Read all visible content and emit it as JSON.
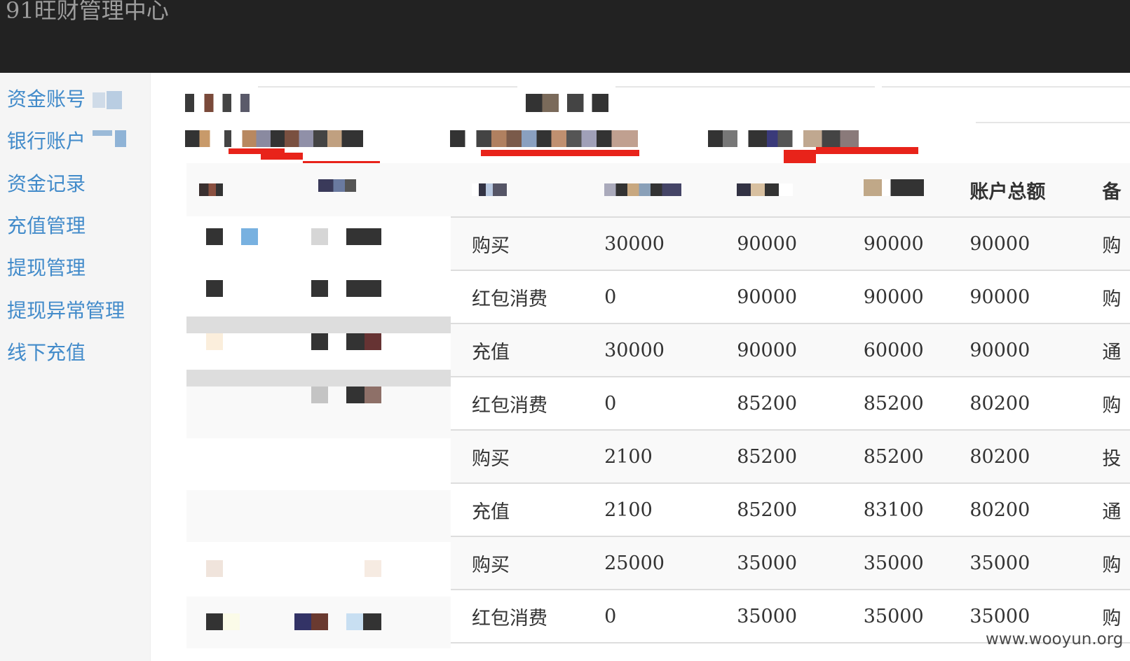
{
  "header": {
    "brand": "91旺财管理中心"
  },
  "sidebar": {
    "items": [
      {
        "label": "资金账号"
      },
      {
        "label": "银行账户"
      },
      {
        "label": "资金记录"
      },
      {
        "label": "充值管理"
      },
      {
        "label": "提现管理"
      },
      {
        "label": "提现异常管理"
      },
      {
        "label": "线下充值"
      }
    ]
  },
  "table": {
    "headers": [
      "",
      "",
      "",
      "",
      "账户总额",
      "备"
    ],
    "rows": [
      [
        "购买",
        "30000",
        "90000",
        "90000",
        "90000",
        "购"
      ],
      [
        "红包消费",
        "0",
        "90000",
        "90000",
        "90000",
        "购"
      ],
      [
        "充值",
        "30000",
        "90000",
        "60000",
        "90000",
        "通"
      ],
      [
        "红包消费",
        "0",
        "85200",
        "85200",
        "80200",
        "购"
      ],
      [
        "购买",
        "2100",
        "85200",
        "85200",
        "80200",
        "投"
      ],
      [
        "充值",
        "2100",
        "85200",
        "83100",
        "80200",
        "通"
      ],
      [
        "购买",
        "25000",
        "35000",
        "35000",
        "35000",
        "购"
      ],
      [
        "红包消费",
        "0",
        "35000",
        "35000",
        "35000",
        "购"
      ]
    ]
  },
  "watermark": "www.wooyun.org",
  "colors": {
    "topbar": "#222222",
    "link": "#428bca",
    "redact": "#e8231a"
  }
}
